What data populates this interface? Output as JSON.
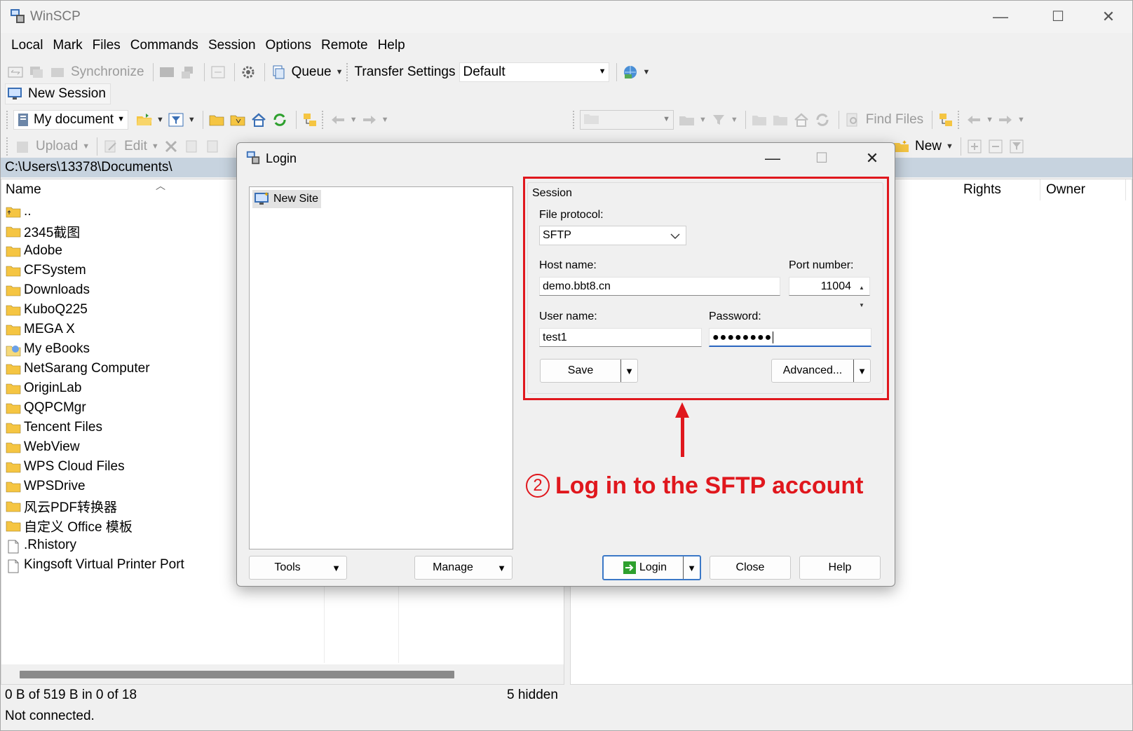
{
  "window": {
    "title": "WinSCP",
    "controls": {
      "minimize": "—",
      "maximize": "☐",
      "close": "✕"
    }
  },
  "menu": [
    "Local",
    "Mark",
    "Files",
    "Commands",
    "Session",
    "Options",
    "Remote",
    "Help"
  ],
  "toolbar": {
    "synchronize": "Synchronize",
    "queue": "Queue",
    "transfer_settings_label": "Transfer Settings",
    "transfer_settings_value": "Default"
  },
  "new_session": "New Session",
  "local_toolbar": {
    "location": "My document",
    "upload": "Upload",
    "edit": "Edit"
  },
  "remote_toolbar": {
    "find_files": "Find Files",
    "new": "New"
  },
  "local_panel": {
    "path": "C:\\Users\\13378\\Documents\\",
    "columns": [
      "Name"
    ],
    "files": [
      {
        "name": "..",
        "type": "up"
      },
      {
        "name": "2345截图",
        "type": "folder"
      },
      {
        "name": "Adobe",
        "type": "folder"
      },
      {
        "name": "CFSystem",
        "type": "folder"
      },
      {
        "name": "Downloads",
        "type": "folder"
      },
      {
        "name": "KuboQ225",
        "type": "folder"
      },
      {
        "name": "MEGA X",
        "type": "folder"
      },
      {
        "name": "My eBooks",
        "type": "special"
      },
      {
        "name": "NetSarang Computer",
        "type": "folder"
      },
      {
        "name": "OriginLab",
        "type": "folder"
      },
      {
        "name": "QQPCMgr",
        "type": "folder"
      },
      {
        "name": "Tencent Files",
        "type": "folder"
      },
      {
        "name": "WebView",
        "type": "folder"
      },
      {
        "name": "WPS Cloud Files",
        "type": "folder"
      },
      {
        "name": "WPSDrive",
        "type": "folder"
      },
      {
        "name": "风云PDF转换器",
        "type": "folder"
      },
      {
        "name": "自定义 Office 模板",
        "type": "folder"
      },
      {
        "name": ".Rhistory",
        "type": "file"
      },
      {
        "name": "Kingsoft Virtual Printer Port",
        "type": "file"
      }
    ]
  },
  "remote_panel": {
    "columns": [
      "Rights",
      "Owner"
    ]
  },
  "status": {
    "selection": "0 B of 519 B in 0 of 18",
    "hidden": "5 hidden",
    "connection": "Not connected."
  },
  "login": {
    "title": "Login",
    "site": "New Site",
    "group": "Session",
    "file_protocol_label": "File protocol:",
    "file_protocol": "SFTP",
    "host_label": "Host name:",
    "host": "demo.bbt8.cn",
    "port_label": "Port number:",
    "port": "11004",
    "user_label": "User name:",
    "user": "test1",
    "password_label": "Password:",
    "password": "●●●●●●●●",
    "save": "Save",
    "advanced": "Advanced...",
    "tools": "Tools",
    "manage": "Manage",
    "login_btn": "Login",
    "close_btn": "Close",
    "help_btn": "Help"
  },
  "annotation": {
    "number": "2",
    "text": "Log in to the SFTP account"
  },
  "colors": {
    "accent": "#e0171d",
    "path_bar": "#c7d3df",
    "folder": "#f5c542"
  }
}
